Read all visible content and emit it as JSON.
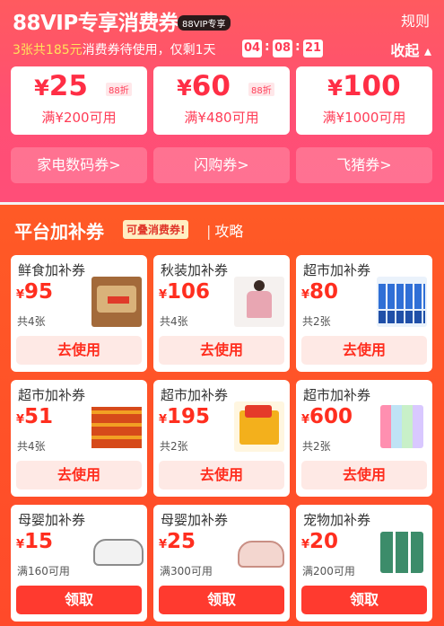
{
  "vip": {
    "title": "88VIP专享消费券",
    "tag": "88VIP专享",
    "rules": "规则",
    "subtitle_prefix": "3张共185元",
    "subtitle_suffix": "消费券待使用，仅剩1天",
    "countdown": [
      "04",
      "08",
      "21"
    ],
    "collapse": "收起 ▴",
    "coupons": [
      {
        "symbol": "¥",
        "amount": "25",
        "discount": "88折",
        "condition": "满¥200可用"
      },
      {
        "symbol": "¥",
        "amount": "60",
        "discount": "88折",
        "condition": "满¥480可用"
      },
      {
        "symbol": "¥",
        "amount": "100",
        "discount": "",
        "condition": "满¥1000可用"
      }
    ],
    "categories": [
      "家电数码券>",
      "闪购券>",
      "飞猪券>"
    ]
  },
  "subsidy": {
    "title": "平台加补券",
    "badge": "可叠消费券!",
    "link": "攻略",
    "cards": [
      {
        "name": "鲜食加补券",
        "symbol": "¥",
        "amount": "95",
        "count": "共4张",
        "button": "去使用",
        "icon": "snack-box-thumbnail"
      },
      {
        "name": "秋装加补券",
        "symbol": "¥",
        "amount": "106",
        "count": "共4张",
        "button": "去使用",
        "icon": "clothing-model-thumbnail"
      },
      {
        "name": "超市加补券",
        "symbol": "¥",
        "amount": "80",
        "count": "共2张",
        "button": "去使用",
        "icon": "toothpaste-pack-thumbnail"
      },
      {
        "name": "超市加补券",
        "symbol": "¥",
        "amount": "51",
        "count": "共4张",
        "button": "去使用",
        "icon": "instant-noodles-thumbnail"
      },
      {
        "name": "超市加补券",
        "symbol": "¥",
        "amount": "195",
        "count": "共2张",
        "button": "去使用",
        "icon": "snack-carton-thumbnail"
      },
      {
        "name": "超市加补券",
        "symbol": "¥",
        "amount": "600",
        "count": "共2张",
        "button": "去使用",
        "icon": "toothpaste-tubes-thumbnail"
      },
      {
        "name": "母婴加补券",
        "symbol": "¥",
        "amount": "15",
        "count": "满160可用",
        "button": "领取",
        "icon": "baby-shoe-gray-thumbnail"
      },
      {
        "name": "母婴加补券",
        "symbol": "¥",
        "amount": "25",
        "count": "满300可用",
        "button": "领取",
        "icon": "baby-shoe-pink-thumbnail"
      },
      {
        "name": "宠物加补券",
        "symbol": "¥",
        "amount": "20",
        "count": "满200可用",
        "button": "领取",
        "icon": "pet-food-thumbnail"
      }
    ]
  },
  "colors": {
    "accent": "#ff2e45",
    "subsidy_bg": "#ff4a2a",
    "vip_bg": "#ff4f74",
    "button_text": "#ff2e1f"
  }
}
